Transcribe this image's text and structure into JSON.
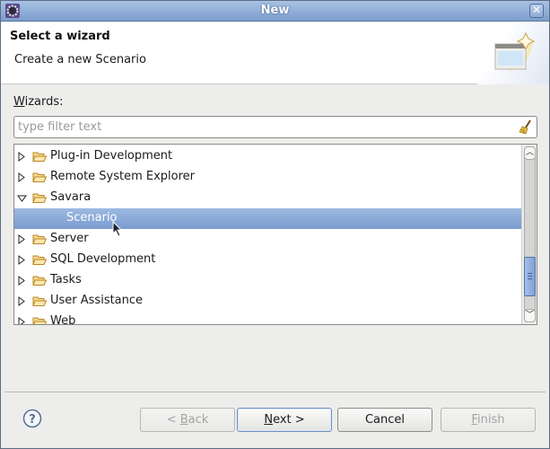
{
  "window": {
    "title": "New"
  },
  "header": {
    "title": "Select a wizard",
    "description": "Create a new Scenario",
    "banner_icon": "new-wizard-icon"
  },
  "wizards": {
    "label_mnemonic": "W",
    "label_rest": "izards:",
    "filter": {
      "value": "",
      "placeholder": "type filter text",
      "clear_icon": "broom-clear-icon"
    },
    "tree": [
      {
        "label": "Plug-in Development",
        "type": "folder",
        "expanded": false
      },
      {
        "label": "Remote System Explorer",
        "type": "folder",
        "expanded": false
      },
      {
        "label": "Savara",
        "type": "folder",
        "expanded": true
      },
      {
        "label": "Scenario",
        "type": "item",
        "selected": true
      },
      {
        "label": "Server",
        "type": "folder",
        "expanded": false
      },
      {
        "label": "SQL Development",
        "type": "folder",
        "expanded": false
      },
      {
        "label": "Tasks",
        "type": "folder",
        "expanded": false
      },
      {
        "label": "User Assistance",
        "type": "folder",
        "expanded": false
      },
      {
        "label": "Web",
        "type": "folder",
        "expanded": false
      }
    ],
    "scroll_position_fraction": 0.72
  },
  "buttons": {
    "back_prefix": "< ",
    "back_mnemonic": "B",
    "back_rest": "ack",
    "next_mnemonic": "N",
    "next_rest": "ext >",
    "cancel": "Cancel",
    "finish_mnemonic": "F",
    "finish_rest": "inish"
  },
  "colors": {
    "selection": "#7a9cd0",
    "titlebar": "#8eaad4"
  }
}
